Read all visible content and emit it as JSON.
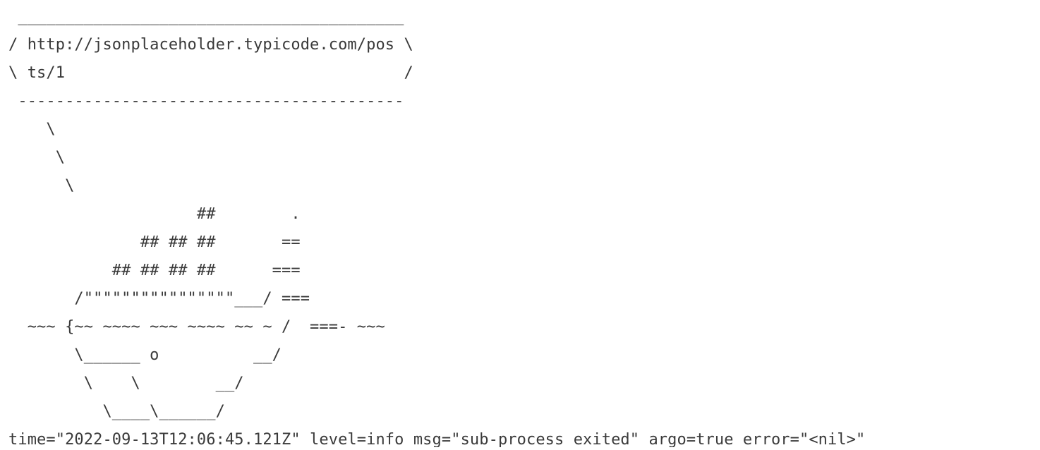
{
  "log": {
    "lines": [
      " _________________________________________",
      "/ http://jsonplaceholder.typicode.com/pos \\",
      "\\ ts/1                                    /",
      " -----------------------------------------",
      "    \\",
      "     \\",
      "      \\",
      "                    ##        .",
      "              ## ## ##       ==",
      "           ## ## ## ##      ===",
      "       /\"\"\"\"\"\"\"\"\"\"\"\"\"\"\"\"___/ ===",
      "  ~~~ {~~ ~~~~ ~~~ ~~~~ ~~ ~ /  ===- ~~~",
      "       \\______ o          __/",
      "        \\    \\        __/",
      "          \\____\\______/",
      "time=\"2022-09-13T12:06:45.121Z\" level=info msg=\"sub-process exited\" argo=true error=\"<nil>\""
    ]
  }
}
